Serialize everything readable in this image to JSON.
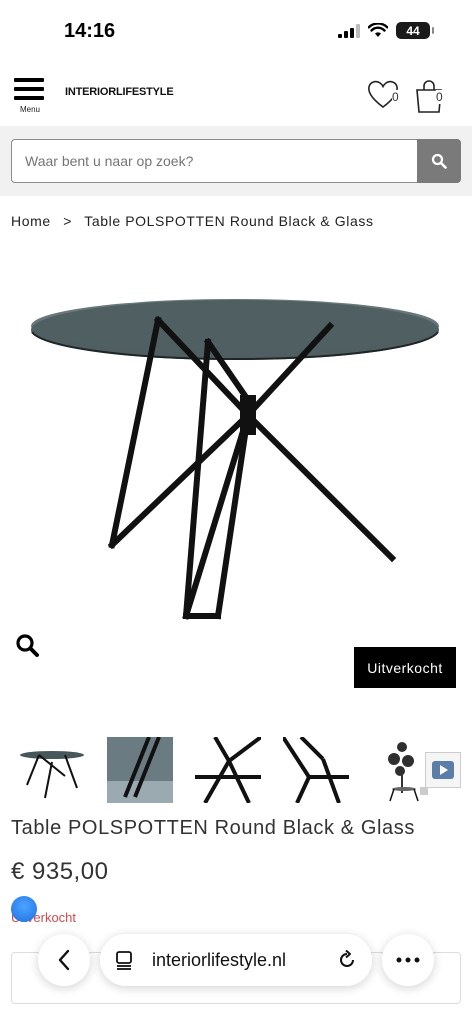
{
  "status_bar": {
    "time": "14:16",
    "battery": "44"
  },
  "header": {
    "menu_label": "Menu",
    "logo_bold": "INTERIOR",
    "logo_rest": "LIFESTYLE",
    "wishlist_count": "0",
    "cart_count": "0"
  },
  "search": {
    "placeholder": "Waar bent u naar op zoek?"
  },
  "breadcrumb": {
    "home": "Home",
    "separator": ">",
    "current": "Table POLSPOTTEN Round Black & Glass"
  },
  "product": {
    "soldout_label": "Uitverkocht",
    "title": "Table POLSPOTTEN Round Black & Glass",
    "price": "€ 935,00",
    "stock_status": "Uitverkocht"
  },
  "browser": {
    "url": "interiorlifestyle.nl"
  },
  "icons": {
    "menu": "menu-icon",
    "heart": "heart-icon",
    "cart": "shopping-bag-icon",
    "search": "search-icon",
    "zoom": "zoom-icon",
    "video": "play-icon",
    "back": "chevron-left-icon",
    "tabs": "tabs-icon",
    "reload": "reload-icon",
    "more": "more-icon"
  },
  "colors": {
    "accent_black": "#000000",
    "stock_red": "#d04b4b",
    "search_button": "#7a7a7a"
  }
}
